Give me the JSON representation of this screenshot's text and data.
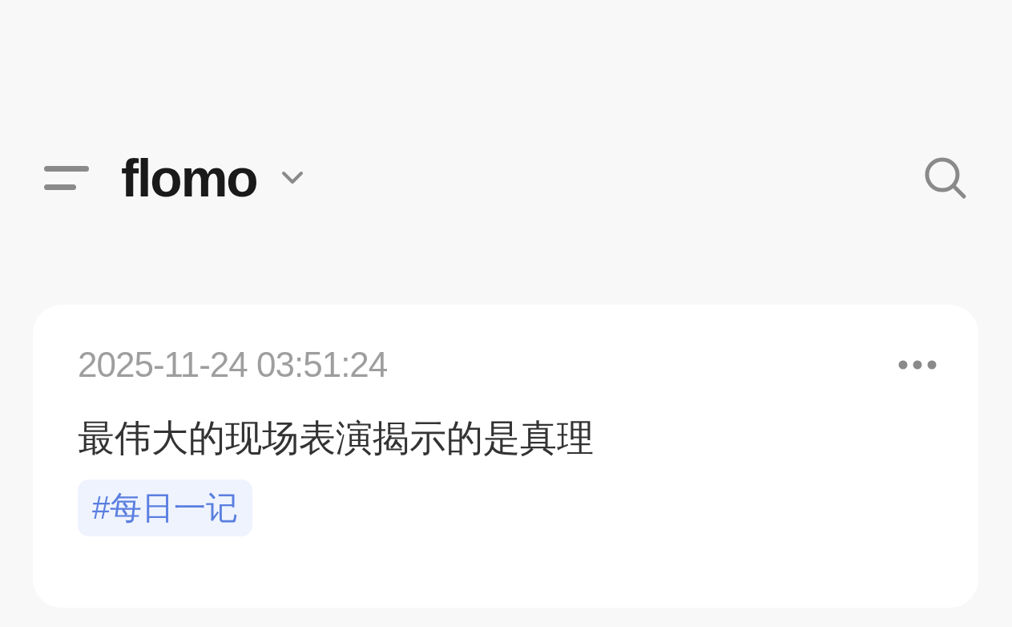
{
  "header": {
    "brand": "flomo"
  },
  "memos": [
    {
      "time": "2025-11-24 03:51:24",
      "content": "最伟大的现场表演揭示的是真理",
      "tags": [
        "#每日一记"
      ]
    }
  ]
}
